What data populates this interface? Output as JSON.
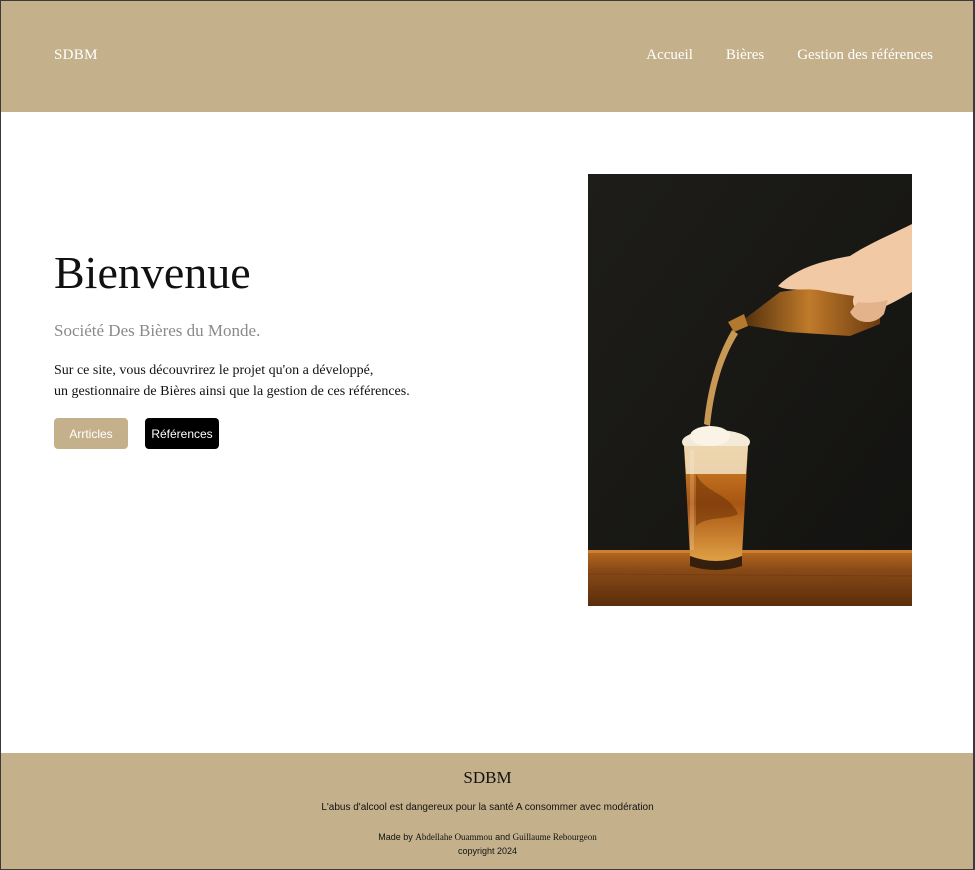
{
  "header": {
    "brand": "SDBM",
    "nav": [
      {
        "label": "Accueil"
      },
      {
        "label": "Bières"
      },
      {
        "label": "Gestion des références"
      }
    ]
  },
  "hero": {
    "title": "Bienvenue",
    "subtitle": "Société Des Bières du Monde.",
    "description_line1": "Sur ce site, vous découvrirez le projet qu'on a développé,",
    "description_line2": "un gestionnaire de Bières ainsi que la gestion de ces références.",
    "buttons": {
      "articles_label": "Arrticles",
      "references_label": "Références"
    },
    "image": "beer-pouring-photo"
  },
  "footer": {
    "brand": "SDBM",
    "warning": "L'abus d'alcool est dangereux pour la santé A consommer avec modération",
    "credit_prefix": "Made by",
    "author1": "Abdellahe Ouammou",
    "credit_and": "and",
    "author2": "Guillaume Rebourgeon",
    "copyright": "copyright 2024"
  },
  "colors": {
    "accent": "#c4b18c",
    "dark_button": "#000000",
    "subtitle_gray": "#8a8a8a"
  }
}
